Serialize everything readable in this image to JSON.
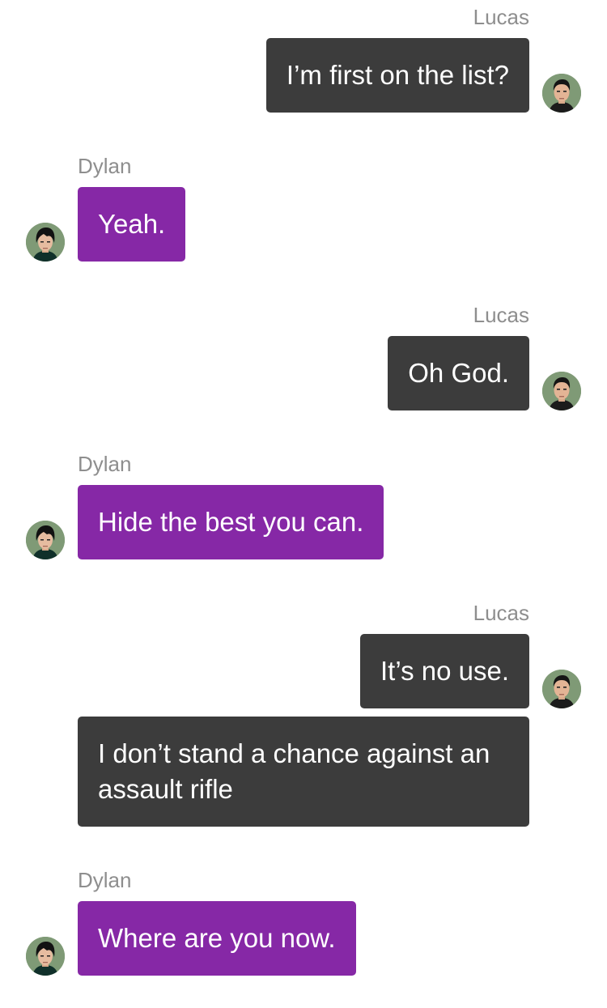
{
  "messages": [
    {
      "sender": "Lucas",
      "text": "I’m first on the list?"
    },
    {
      "sender": "Dylan",
      "text": "Yeah."
    },
    {
      "sender": "Lucas",
      "text": "Oh God."
    },
    {
      "sender": "Dylan",
      "text": "Hide the best you can."
    },
    {
      "sender": "Lucas",
      "text": "It’s no use."
    },
    {
      "sender": "Lucas",
      "text": "I don’t stand a chance against an assault rifle"
    },
    {
      "sender": "Dylan",
      "text": "Where are you now."
    }
  ],
  "colors": {
    "lucas_bubble": "#3c3c3c",
    "dylan_bubble": "#8628a6",
    "name_label": "#8e8e8e",
    "avatar_background": "#7f9a76"
  },
  "icons": {
    "lucas_avatar": "male-portrait-short-hair",
    "dylan_avatar": "male-portrait-bangs"
  }
}
